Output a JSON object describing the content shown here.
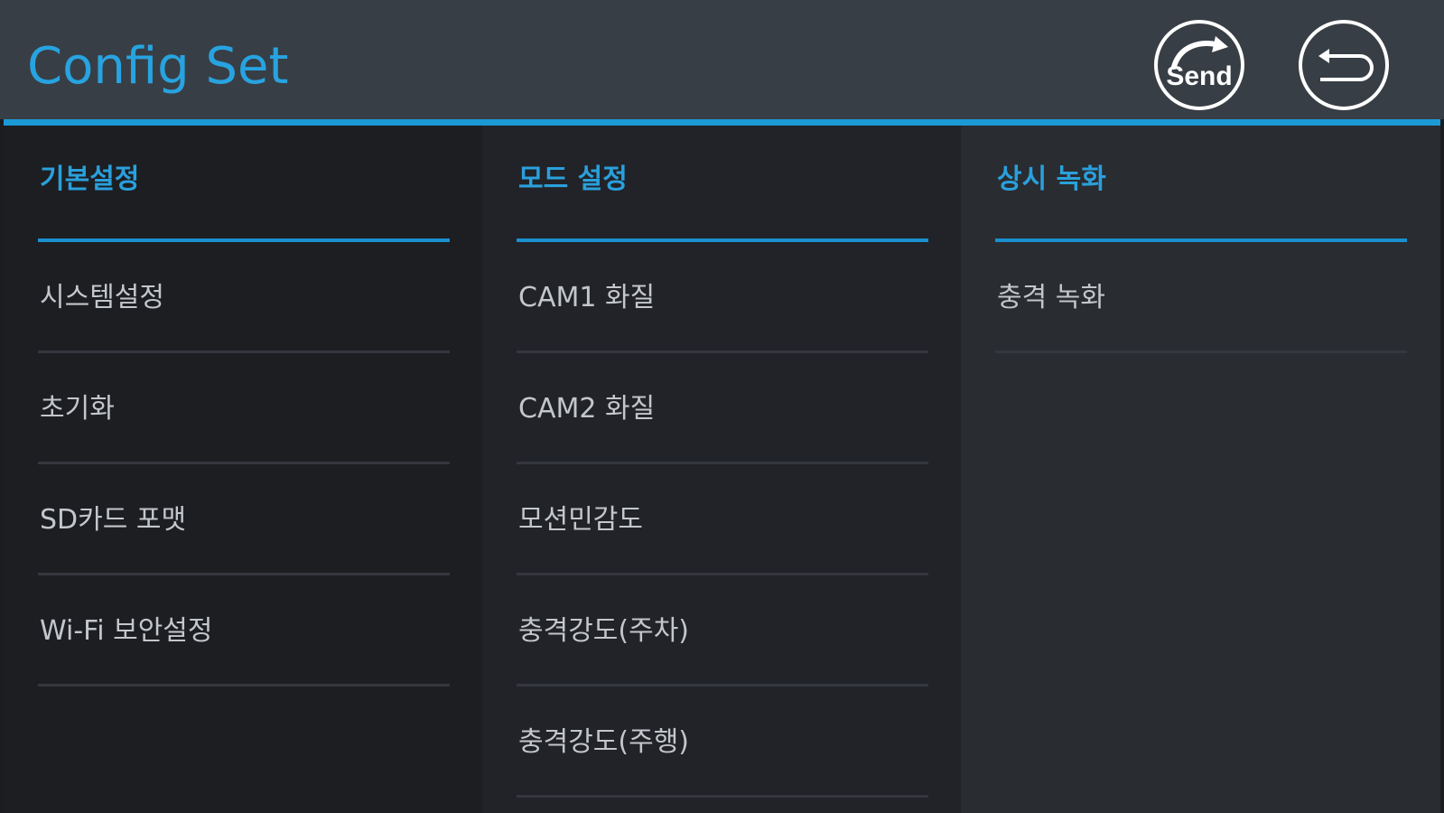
{
  "header": {
    "title": "Config Set",
    "send_button": {
      "label": "Send",
      "icon": "send-arrow-icon"
    },
    "back_button": {
      "icon": "return-arrow-icon"
    }
  },
  "colors": {
    "accent": "#1b9ad6",
    "header_bg": "#383e45",
    "text": "#c3c6cb"
  },
  "columns": [
    {
      "header": "기본설정",
      "items": [
        "시스템설정",
        "초기화",
        "SD카드 포맷",
        "Wi-Fi 보안설정"
      ]
    },
    {
      "header": "모드 설정",
      "items": [
        "CAM1 화질",
        "CAM2 화질",
        "모션민감도",
        "충격강도(주차)",
        "충격강도(주행)"
      ]
    },
    {
      "header": "상시 녹화",
      "items": [
        "충격 녹화"
      ]
    }
  ]
}
